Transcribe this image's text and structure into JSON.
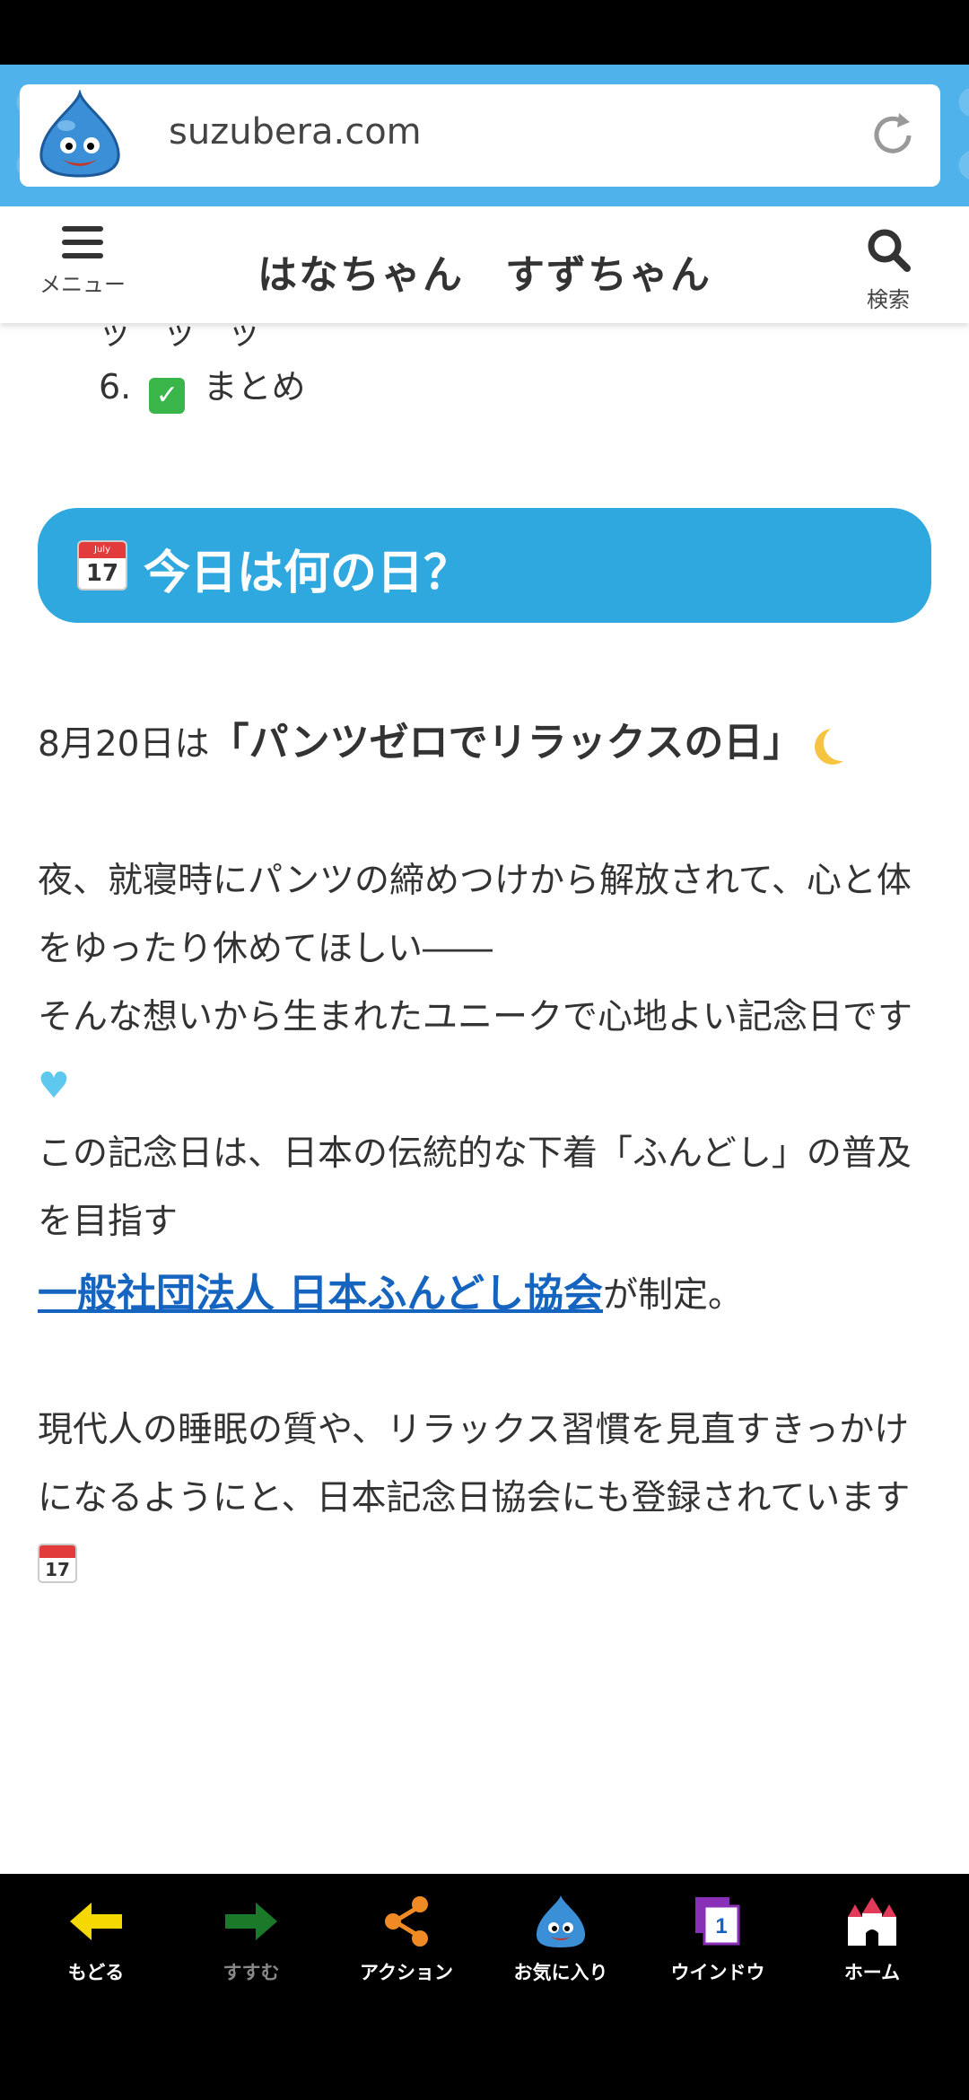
{
  "browser": {
    "url": "suzubera.com"
  },
  "site": {
    "title": "はなちゃん　すずちゃん",
    "menu_label": "メニュー",
    "search_label": "検索"
  },
  "toc": {
    "partial_text": "ッ　ッ　ッ",
    "item_number": "6.",
    "item_text": "まとめ"
  },
  "section": {
    "calendar_month": "July",
    "calendar_day": "17",
    "heading": "今日は何の日？"
  },
  "article": {
    "date_prefix": "8月20日は",
    "day_name": "「パンツゼロでリラックスの日」",
    "para1": "夜、就寝時にパンツの締めつけから解放されて、心と体をゆったり休めてほしい――",
    "para2": "そんな想いから生まれたユニークで心地よい記念日です",
    "para3": "この記念日は、日本の伝統的な下着「ふんどし」の普及を目指す",
    "link_text": "一般社団法人 日本ふんどし協会",
    "link_suffix": "が制定。",
    "para4": "現代人の睡眠の質や、リラックス習慣を見直すきっかけになるようにと、日本記念日協会にも登録されています"
  },
  "bottom_nav": {
    "back": "もどる",
    "forward": "すすむ",
    "action": "アクション",
    "favorites": "お気に入り",
    "window": "ウインドウ",
    "window_count": "1",
    "home": "ホーム"
  },
  "colors": {
    "accent_blue": "#2fa8e0",
    "link_blue": "#1565c0",
    "back_yellow": "#f5d800",
    "forward_green": "#1a7a2a",
    "action_orange": "#f08a24"
  }
}
